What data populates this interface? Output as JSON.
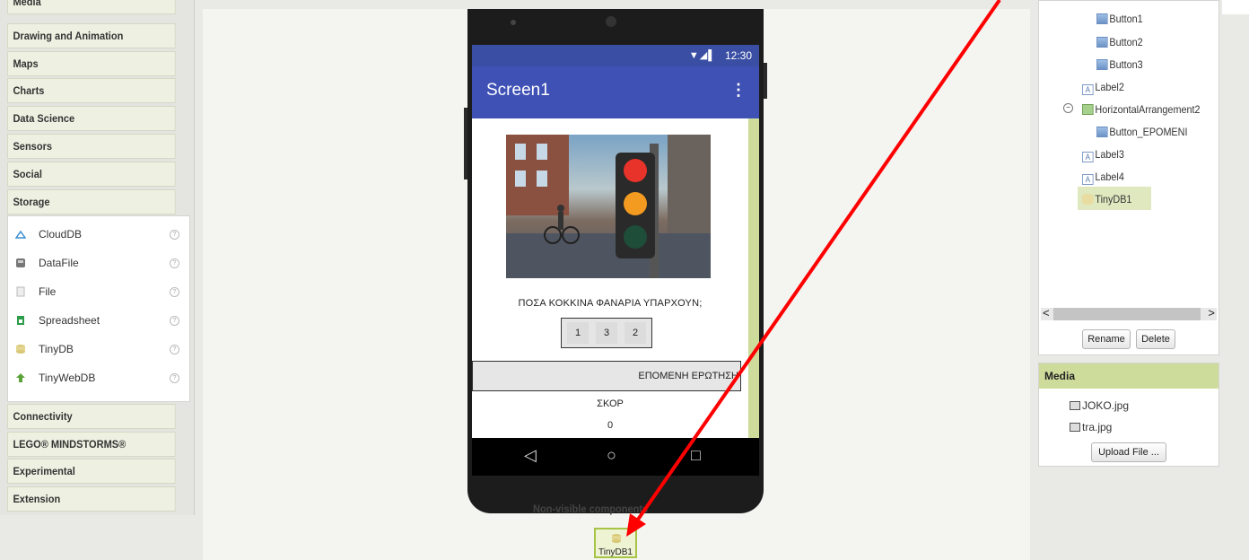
{
  "palette": {
    "categories_top": [
      "Media",
      "Drawing and Animation",
      "Maps",
      "Charts",
      "Data Science",
      "Sensors",
      "Social",
      "Storage"
    ],
    "storage_items": [
      {
        "label": "CloudDB",
        "icon": "cloud-icon"
      },
      {
        "label": "DataFile",
        "icon": "datafile-icon"
      },
      {
        "label": "File",
        "icon": "file-icon"
      },
      {
        "label": "Spreadsheet",
        "icon": "spreadsheet-icon"
      },
      {
        "label": "TinyDB",
        "icon": "tinydb-icon"
      },
      {
        "label": "TinyWebDB",
        "icon": "tinywebdb-icon"
      }
    ],
    "help_glyph": "?",
    "categories_bottom": [
      "Connectivity",
      "LEGO® MINDSTORMS®",
      "Experimental",
      "Extension"
    ]
  },
  "phone": {
    "time": "12:30",
    "signal": "▼◢▌",
    "screen_title": "Screen1",
    "menu": "⋮",
    "question": "ΠΟΣΑ ΚΟΚΚΙΝΑ ΦΑΝΑΡΙΑ ΥΠΑΡΧΟΥΝ;",
    "answers": [
      "1",
      "3",
      "2"
    ],
    "next_button": "ΕΠΟΜΕΝΗ ΕΡΩΤΗΣΗ",
    "score_label": "ΣΚΟΡ",
    "score_value": "0",
    "nav": {
      "back": "◁",
      "home": "○",
      "recent": "□"
    }
  },
  "nonvisible": {
    "label": "Non-visible components",
    "component": "TinyDB1"
  },
  "components_tree": {
    "items": [
      "Button1",
      "Button2",
      "Button3",
      "Label2",
      "HorizontalArrangement2",
      "Button_EPOMENI",
      "Label3",
      "Label4",
      "TinyDB1"
    ],
    "collapse_glyph": "−",
    "scroll_left": "<",
    "scroll_right": ">",
    "rename": "Rename",
    "delete": "Delete"
  },
  "media": {
    "title": "Media",
    "files": [
      "JOKO.jpg",
      "tra.jpg"
    ],
    "upload": "Upload File ..."
  },
  "colors": {
    "accent_green": "#cddc9a",
    "app_bar": "#3f51b5",
    "arrow": "#ff0000"
  }
}
